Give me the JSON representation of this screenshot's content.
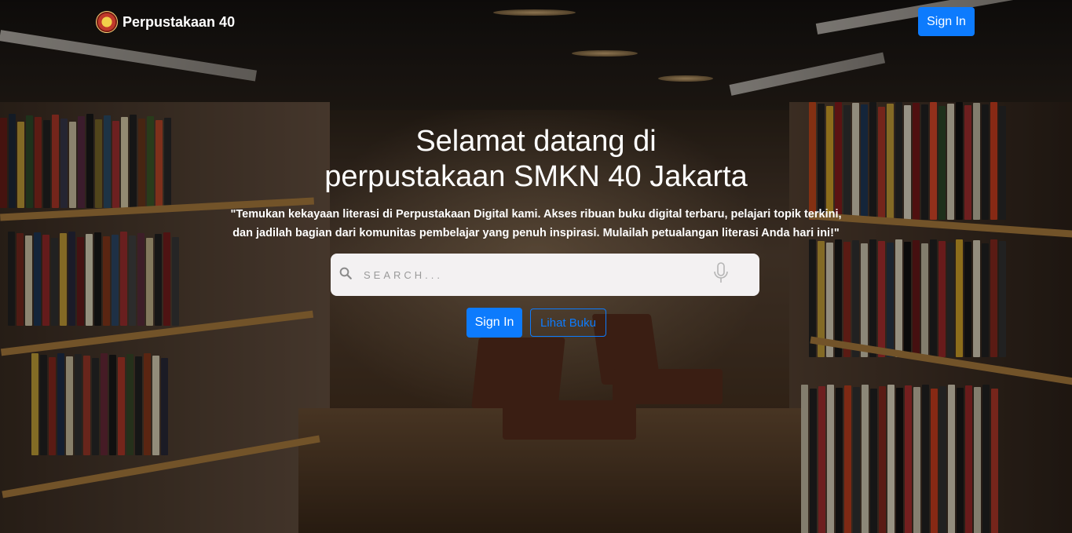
{
  "brand": {
    "name": "Perpustakaan 40",
    "logo_icon": "school-emblem-icon"
  },
  "header": {
    "signin_label": "Sign In"
  },
  "hero": {
    "title_line1": "Selamat datang di",
    "title_line2": "perpustakaan SMKN 40 Jakarta",
    "desc_line1": "\"Temukan kekayaan literasi di Perpustakaan Digital kami. Akses ribuan buku digital terbaru, pelajari topik terkini,",
    "desc_line2": "dan jadilah bagian dari komunitas pembelajar yang penuh inspirasi. Mulailah petualangan literasi Anda hari ini!\""
  },
  "search": {
    "placeholder": "SEARCH...",
    "search_icon": "search-icon",
    "mic_icon": "microphone-icon"
  },
  "actions": {
    "signin_label": "Sign In",
    "books_label": "Lihat Buku"
  },
  "colors": {
    "primary": "#0d7bfd",
    "search_bg": "#f3f1f2"
  }
}
